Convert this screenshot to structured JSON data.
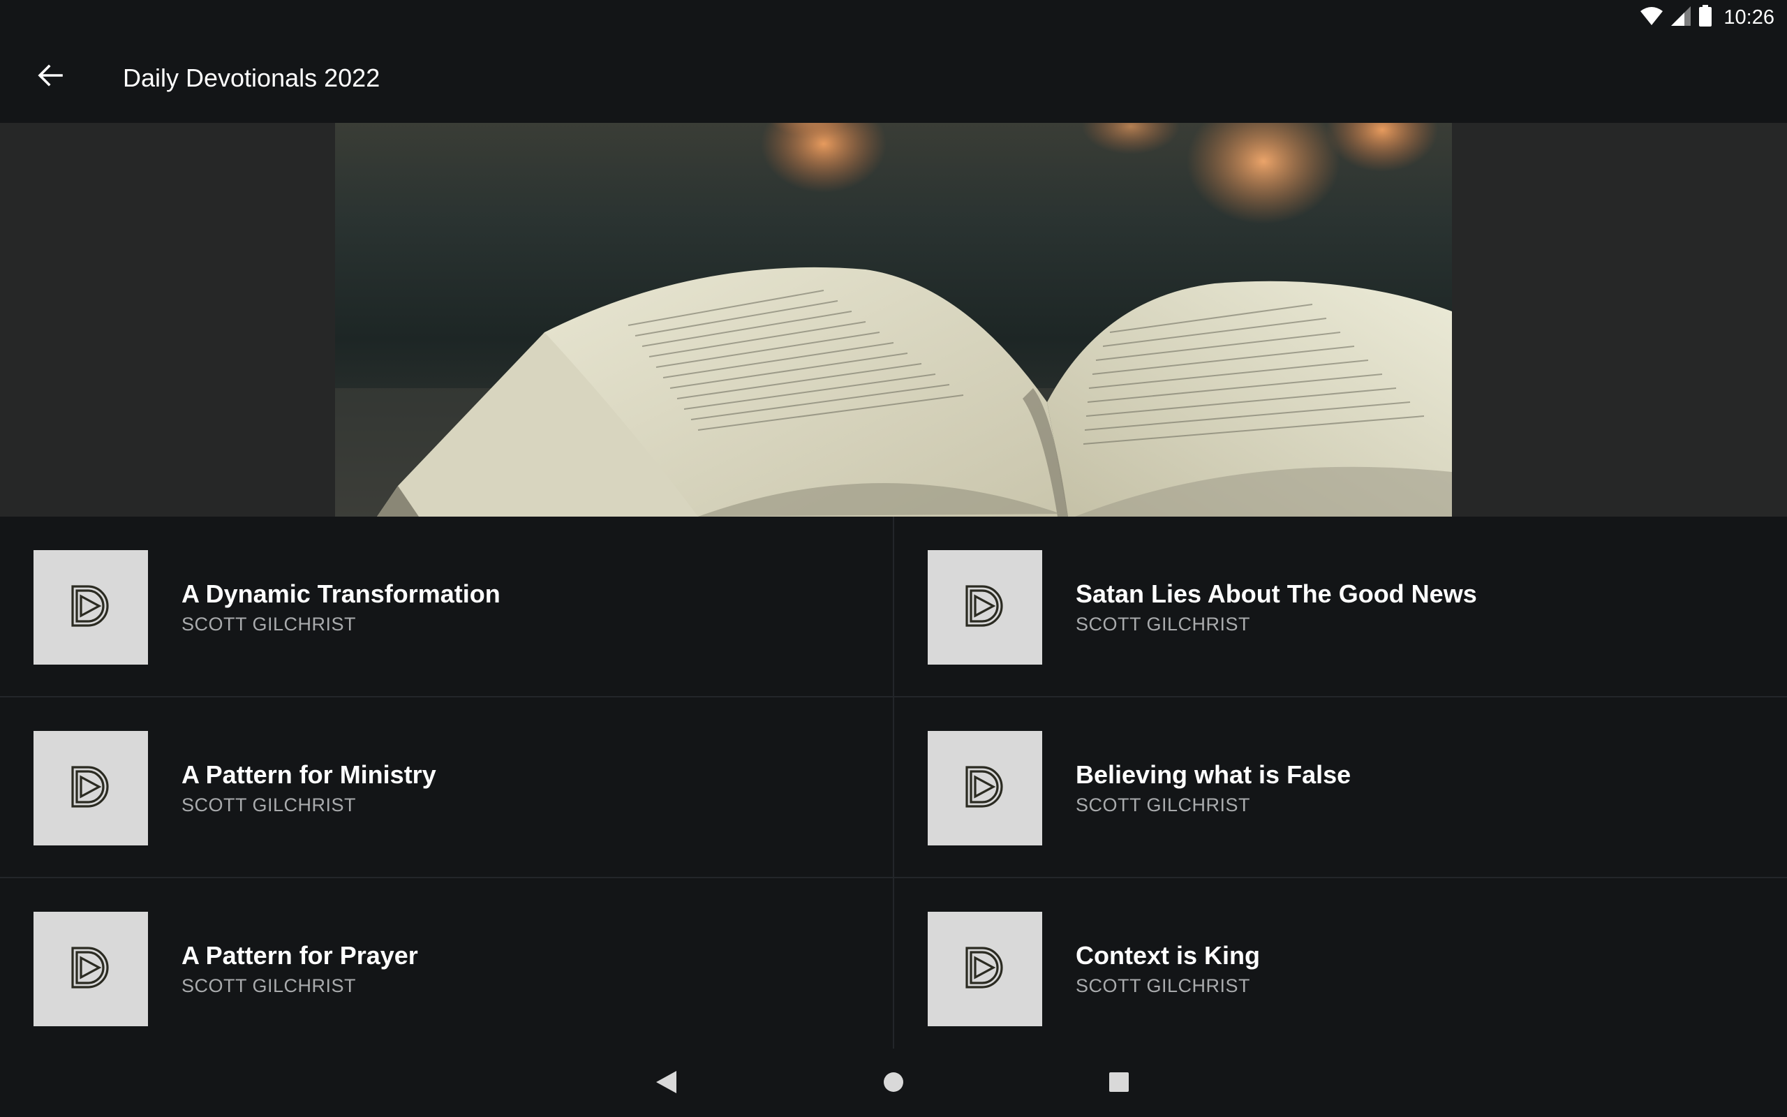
{
  "status_bar": {
    "time": "10:26",
    "icons": [
      "wifi-icon",
      "cell-signal-icon",
      "battery-icon"
    ]
  },
  "app_bar": {
    "back_icon": "arrow-back-icon",
    "title": "Daily Devotionals 2022"
  },
  "hero": {
    "image": "open-bible-photo"
  },
  "items": [
    {
      "title": "A Dynamic Transformation",
      "author": "SCOTT GILCHRIST",
      "thumb_icon": "devotional-logo-icon"
    },
    {
      "title": "Satan Lies About The Good News",
      "author": "SCOTT GILCHRIST",
      "thumb_icon": "devotional-logo-icon"
    },
    {
      "title": "A Pattern for Ministry",
      "author": "SCOTT GILCHRIST",
      "thumb_icon": "devotional-logo-icon"
    },
    {
      "title": "Believing what is False",
      "author": "SCOTT GILCHRIST",
      "thumb_icon": "devotional-logo-icon"
    },
    {
      "title": "A Pattern for Prayer",
      "author": "SCOTT GILCHRIST",
      "thumb_icon": "devotional-logo-icon"
    },
    {
      "title": "Context is King",
      "author": "SCOTT GILCHRIST",
      "thumb_icon": "devotional-logo-icon"
    }
  ],
  "nav_bar": {
    "icons": [
      "nav-back-icon",
      "nav-home-icon",
      "nav-recents-icon"
    ]
  },
  "colors": {
    "background": "#131517",
    "hero_background": "#262727",
    "thumb_background": "#d9d9d9",
    "divider": "#23262a",
    "author_text": "#a9abad"
  }
}
